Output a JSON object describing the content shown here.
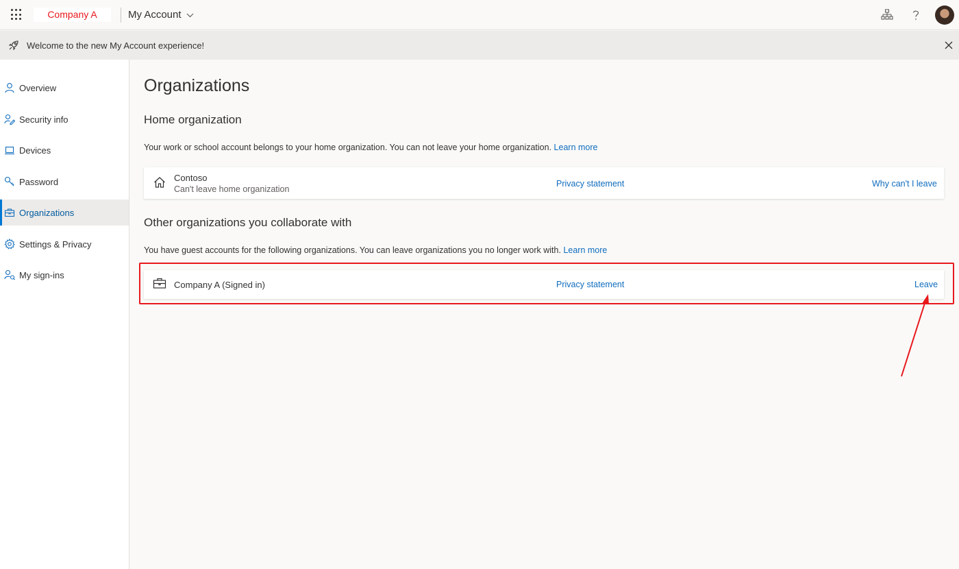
{
  "header": {
    "brand": "Company A",
    "app_title": "My Account",
    "icons": [
      "waffle-icon",
      "chevron-down-icon",
      "org-chart-icon",
      "help-icon",
      "avatar"
    ]
  },
  "banner": {
    "text": "Welcome to the new My Account experience!",
    "icons": [
      "rocket-icon",
      "close-icon"
    ]
  },
  "sidebar": {
    "items": [
      {
        "label": "Overview",
        "icon": "person-icon"
      },
      {
        "label": "Security info",
        "icon": "security-info-icon"
      },
      {
        "label": "Devices",
        "icon": "laptop-icon"
      },
      {
        "label": "Password",
        "icon": "key-icon"
      },
      {
        "label": "Organizations",
        "icon": "briefcase-icon",
        "active": true
      },
      {
        "label": "Settings & Privacy",
        "icon": "gear-icon"
      },
      {
        "label": "My sign-ins",
        "icon": "sign-ins-icon"
      }
    ]
  },
  "main": {
    "title": "Organizations",
    "home": {
      "heading": "Home organization",
      "description": "Your work or school account belongs to your home organization. You can not leave your home organization.",
      "learn_more": "Learn more",
      "org": {
        "name": "Contoso",
        "subtitle": "Can't leave home organization",
        "privacy": "Privacy statement",
        "action": "Why can't I leave",
        "icon": "home-icon"
      }
    },
    "other": {
      "heading": "Other organizations you collaborate with",
      "description": "You have guest accounts for the following organizations. You can leave organizations you no longer work with.",
      "learn_more": "Learn more",
      "orgs": [
        {
          "name": "Company A (Signed in)",
          "privacy": "Privacy statement",
          "action": "Leave",
          "icon": "briefcase-icon"
        }
      ]
    }
  },
  "colors": {
    "accent": "#0f6cbd",
    "brand_red": "#e8181c",
    "annotation": "#e8181c"
  }
}
